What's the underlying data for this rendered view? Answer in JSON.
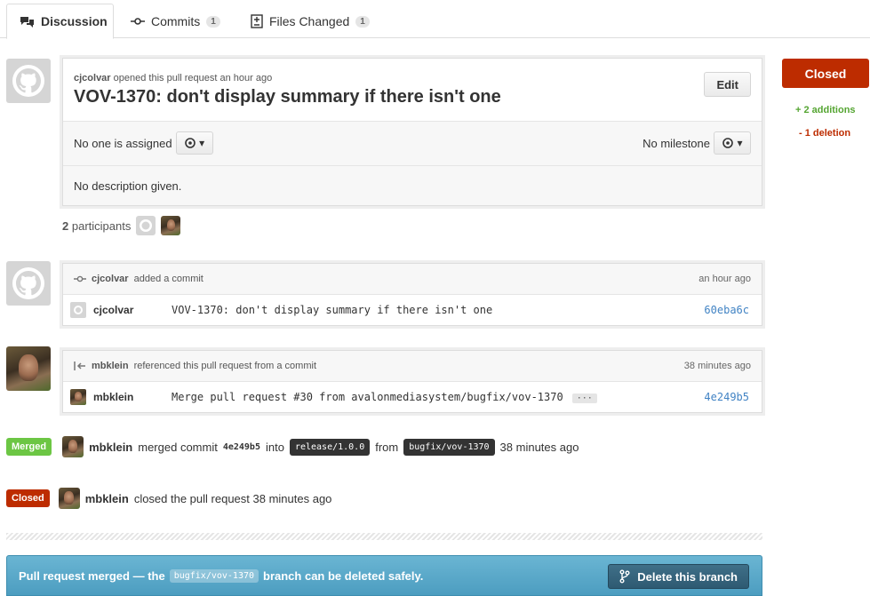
{
  "tabs": [
    {
      "label": "Discussion",
      "icon": "comment-discussion-icon",
      "active": true
    },
    {
      "label": "Commits",
      "icon": "git-commit-icon",
      "count": "1"
    },
    {
      "label": "Files Changed",
      "icon": "diff-icon",
      "count": "1"
    }
  ],
  "pr": {
    "author": "cjcolvar",
    "opened_text": "opened this pull request an hour ago",
    "title": "VOV-1370: don't display summary if there isn't one",
    "edit_label": "Edit",
    "assignee_text": "No one is assigned",
    "milestone_text": "No milestone",
    "description": "No description given.",
    "participants_count": "2",
    "participants_label": "participants"
  },
  "sidebar": {
    "state_label": "Closed",
    "additions": "+ 2 additions",
    "deletions": "- 1 deletion"
  },
  "events": {
    "commit": {
      "actor": "cjcolvar",
      "action": "added a commit",
      "time": "an hour ago",
      "commit_author": "cjcolvar",
      "message": "VOV-1370: don't display summary if there isn't one",
      "sha": "60eba6c"
    },
    "reference": {
      "actor": "mbklein",
      "action": "referenced this pull request from a commit",
      "time": "38 minutes ago",
      "commit_author": "mbklein",
      "message": "Merge pull request #30 from avalonmediasystem/bugfix/vov-1370",
      "more": "···",
      "sha": "4e249b5"
    },
    "merged": {
      "badge": "Merged",
      "actor": "mbklein",
      "text1": "merged commit",
      "sha": "4e249b5",
      "text2": "into",
      "target_branch": "release/1.0.0",
      "text3": "from",
      "source_branch": "bugfix/vov-1370",
      "time": "38 minutes ago"
    },
    "closed": {
      "badge": "Closed",
      "actor": "mbklein",
      "text": "closed the pull request 38 minutes ago"
    }
  },
  "merge_bar": {
    "text_before": "Pull request merged — the",
    "branch": "bugfix/vov-1370",
    "text_after": "branch can be deleted safely.",
    "delete_label": "Delete this branch"
  },
  "colors": {
    "closed_red": "#bd2c00",
    "merged_green": "#6cc644",
    "link_blue": "#4183c4",
    "merge_bar_blue": "#4c9dc0"
  }
}
